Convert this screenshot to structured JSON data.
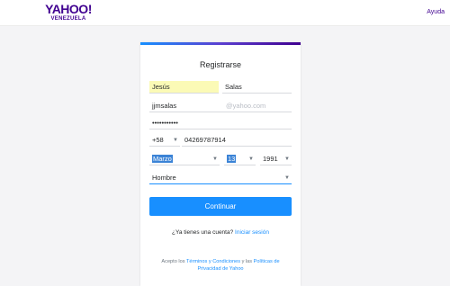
{
  "header": {
    "logo_main": "YAHOO!",
    "logo_sub": "VENEZUELA",
    "help_label": "Ayuda"
  },
  "form": {
    "title": "Registrarse",
    "first_name": "Jesús",
    "last_name": "Salas",
    "username": "jjmsalas",
    "username_suffix": "@yahoo.com",
    "password": "•••••••••••",
    "country_code": "+58",
    "phone": "04269787914",
    "birth_month": "Marzo",
    "birth_day": "13",
    "birth_year": "1991",
    "gender": "Hombre",
    "submit_label": "Continuar",
    "have_account_text": "¿Ya tienes una cuenta?",
    "signin_link": "Iniciar sesión",
    "terms_prefix": "Acepto los",
    "terms_link": "Términos y Condiciones",
    "terms_and": "y las",
    "privacy_link": "Políticas de Privacidad de Yahoo"
  },
  "colors": {
    "brand": "#400090",
    "accent": "#188fff",
    "autofill": "#fbfab6",
    "selection": "#3b83d6"
  },
  "icons": {
    "dropdown": "chevron-down-icon"
  }
}
